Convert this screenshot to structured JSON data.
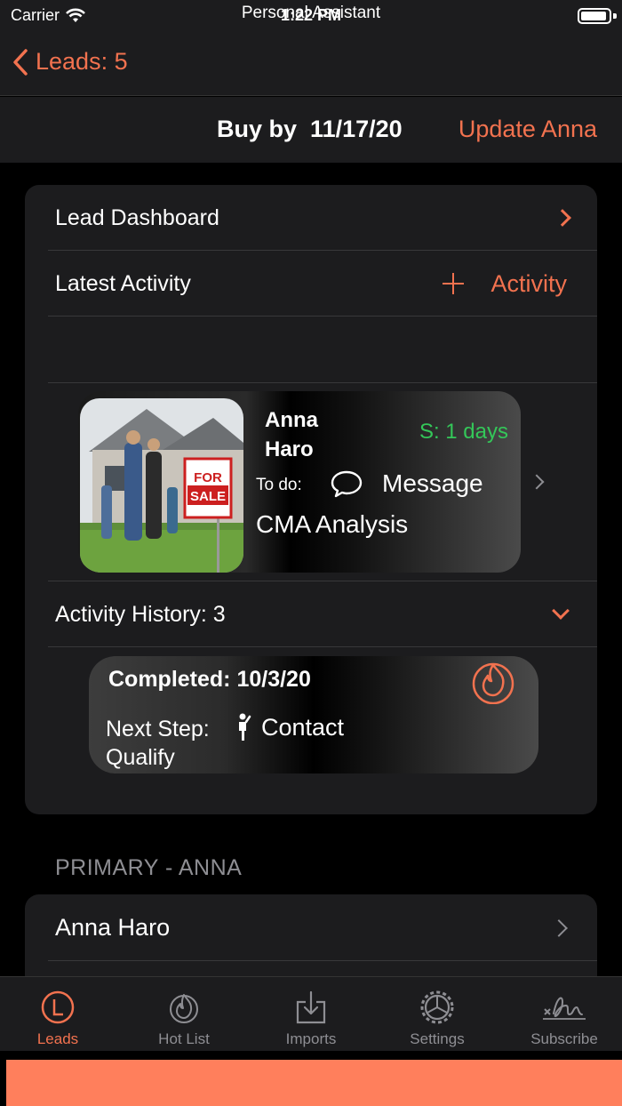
{
  "status_bar": {
    "carrier": "Carrier",
    "time": "1:22 PM"
  },
  "nav": {
    "back_label": "Leads: 5"
  },
  "sub_header": {
    "buy_by_label": "Buy by",
    "buy_by_date": "11/17/20",
    "update_label": "Update Anna"
  },
  "card": {
    "dashboard_label": "Lead Dashboard",
    "latest_activity_label": "Latest Activity",
    "add_activity_label": "Activity",
    "lead": {
      "first_name": "Anna",
      "last_name": "Haro",
      "status": "S: 1 days",
      "todo_label": "To do:",
      "todo_action": "Message",
      "task": "CMA Analysis",
      "photo_sign": "FOR SALE"
    },
    "history_label": "Activity History: 3",
    "history_item": {
      "completed": "Completed: 10/3/20",
      "next_step_label": "Next Step:",
      "next_step_action": "Contact",
      "stage": "Qualify"
    }
  },
  "section_header": "PRIMARY - ANNA",
  "contact": {
    "name": "Anna Haro"
  },
  "tabs": [
    {
      "label": "Leads",
      "icon": "leads-icon",
      "active": true
    },
    {
      "label": "Hot List",
      "icon": "flame-icon",
      "active": false
    },
    {
      "label": "Imports",
      "icon": "import-icon",
      "active": false
    },
    {
      "label": "Settings",
      "icon": "gear-icon",
      "active": false
    },
    {
      "label": "Subscribe",
      "icon": "signature-icon",
      "active": false
    }
  ],
  "assistant_label": "Personal Assistant",
  "colors": {
    "accent": "#f2724f",
    "status_green": "#34c759",
    "assistant_bar": "#ff7f5c"
  }
}
